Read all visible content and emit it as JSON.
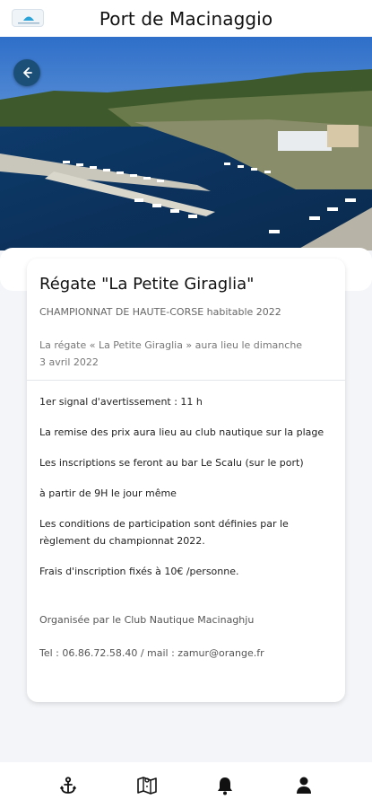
{
  "header": {
    "title": "Port de Macinaggio",
    "logo_icon": "port-logo-icon"
  },
  "hero": {
    "image_desc": "aerial-harbor-photo",
    "back_icon": "arrow-left-icon"
  },
  "event": {
    "title": "Régate \"La Petite Giraglia\"",
    "subtitle": "CHAMPIONNAT DE HAUTE-CORSE habitable 2022",
    "date_line1": "La régate « La Petite Giraglia » aura lieu le dimanche",
    "date_line2": "3 avril 2022",
    "paragraphs": [
      "1er signal d'avertissement : 11 h",
      "La remise des prix aura lieu au club nautique sur la plage",
      "Les inscriptions se feront au bar Le Scalu (sur le port)",
      "à partir de 9H le jour même",
      "Les conditions de participation sont définies par le règlement du championnat 2022.",
      "Frais d'inscription fixés à 10€ /personne."
    ],
    "organizer": "Organisée par le Club Nautique Macinaghju",
    "contact": "Tel : 06.86.72.58.40 / mail : zamur@orange.fr"
  },
  "bottom_nav": [
    {
      "icon": "anchor-icon"
    },
    {
      "icon": "map-icon"
    },
    {
      "icon": "bell-icon"
    },
    {
      "icon": "user-icon"
    }
  ]
}
